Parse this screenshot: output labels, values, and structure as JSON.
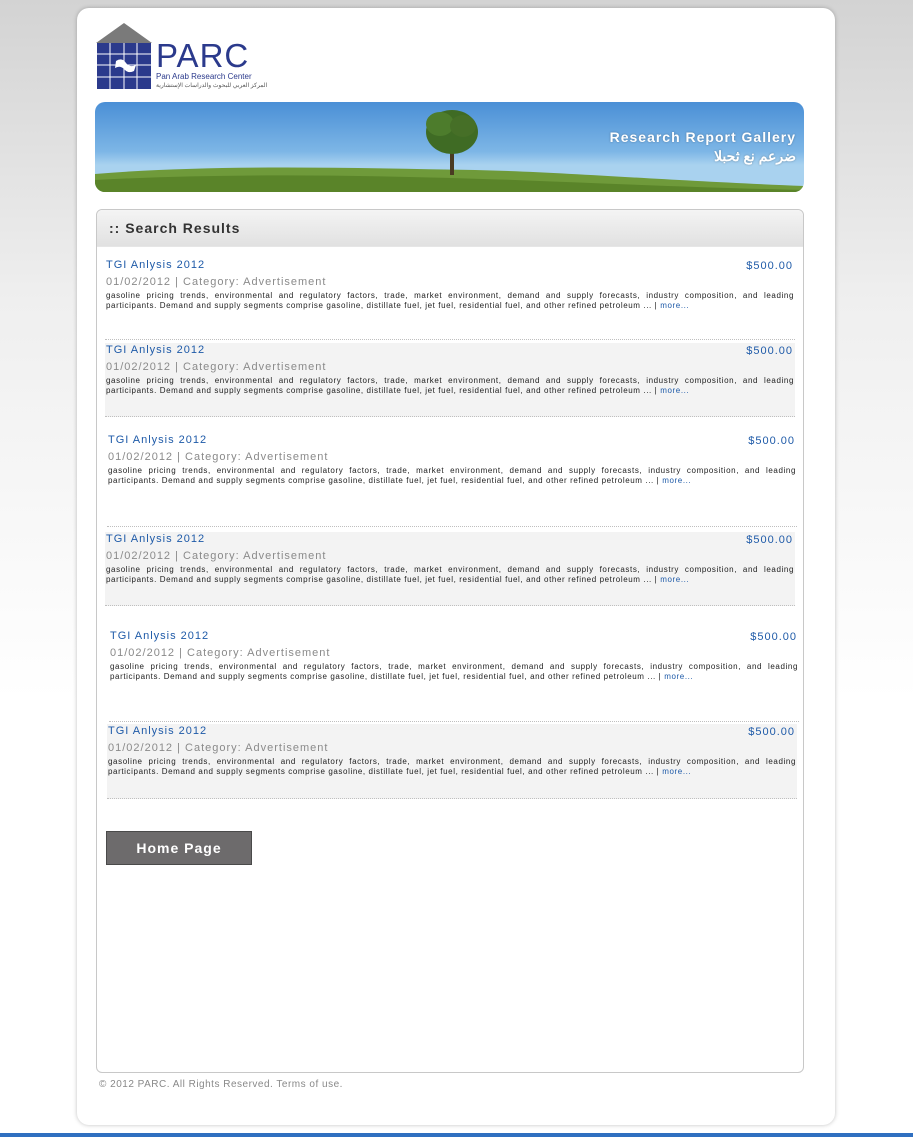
{
  "brand": {
    "name": "PARC",
    "subtitle": "Pan Arab Research Center",
    "subtitle_ar": "المركز العربي للبحوث والدراسات الإستشارية"
  },
  "banner": {
    "title": "Research Report Gallery",
    "title_ar": "ضرعم نع ثحبلا"
  },
  "panel": {
    "title": ":: Search Results"
  },
  "results": [
    {
      "title": "TGI Anlysis 2012",
      "price": "$500.00",
      "meta": "01/02/2012 | Category: Advertisement",
      "desc": "gasoline pricing trends, environmental and regulatory factors, trade, market environment, demand and supply forecasts, industry composition, and leading participants. Demand and supply segments comprise gasoline, distillate fuel, jet fuel, residential fuel, and other refined petroleum ... |",
      "more": "more..."
    },
    {
      "title": "TGI Anlysis 2012",
      "price": "$500.00",
      "meta": "01/02/2012 | Category: Advertisement",
      "desc": "gasoline pricing trends, environmental and regulatory factors, trade, market environment, demand and supply forecasts, industry composition, and leading participants. Demand and supply segments comprise gasoline, distillate fuel, jet fuel, residential fuel, and other refined petroleum ... |",
      "more": "more..."
    },
    {
      "title": "TGI Anlysis 2012",
      "price": "$500.00",
      "meta": "01/02/2012 | Category: Advertisement",
      "desc": "gasoline pricing trends, environmental and regulatory factors, trade, market environment, demand and supply forecasts, industry composition, and leading participants. Demand and supply segments comprise gasoline, distillate fuel, jet fuel, residential fuel, and other refined petroleum ... |",
      "more": "more..."
    },
    {
      "title": "TGI Anlysis 2012",
      "price": "$500.00",
      "meta": "01/02/2012 | Category: Advertisement",
      "desc": "gasoline pricing trends, environmental and regulatory factors, trade, market environment, demand and supply forecasts, industry composition, and leading participants. Demand and supply segments comprise gasoline, distillate fuel, jet fuel, residential fuel, and other refined petroleum ... |",
      "more": "more..."
    },
    {
      "title": "TGI Anlysis 2012",
      "price": "$500.00",
      "meta": "01/02/2012 | Category: Advertisement",
      "desc": "gasoline pricing trends, environmental and regulatory factors, trade, market environment, demand and supply forecasts, industry composition, and leading participants. Demand and supply segments comprise gasoline, distillate fuel, jet fuel, residential fuel, and other refined petroleum ... |",
      "more": "more..."
    },
    {
      "title": "TGI Anlysis 2012",
      "price": "$500.00",
      "meta": "01/02/2012 | Category: Advertisement",
      "desc": "gasoline pricing trends, environmental and regulatory factors, trade, market environment, demand and supply forecasts, industry composition, and leading participants. Demand and supply segments comprise gasoline, distillate fuel, jet fuel, residential fuel, and other refined petroleum ... |",
      "more": "more..."
    }
  ],
  "home_button": "Home Page",
  "footer": "© 2012 PARC. All Rights Reserved. Terms of use.",
  "colors": {
    "link": "#1e5aa8",
    "button": "#6d6b6c",
    "logo": "#2b3a8c"
  }
}
